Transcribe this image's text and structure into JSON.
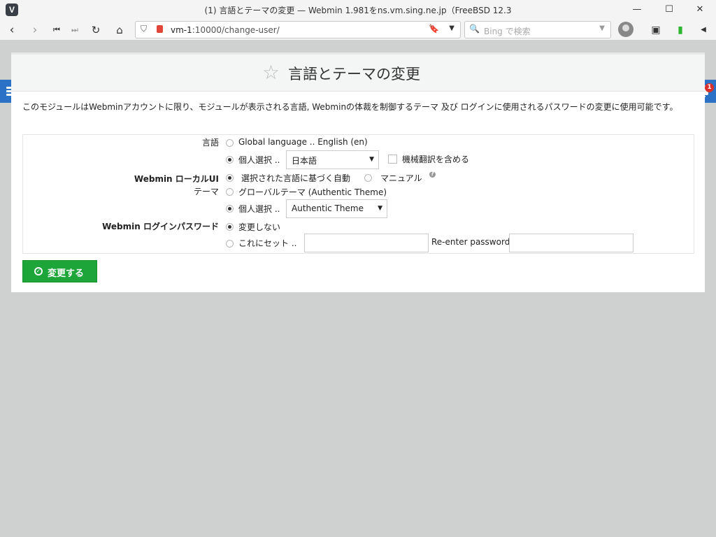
{
  "window": {
    "title": "(1) 言語とテーマの変更 — Webmin 1.981をns.vm.sing.ne.jp（FreeBSD 12.3",
    "minimize": "—",
    "maximize": "☐",
    "close": "✕"
  },
  "browser": {
    "back_icon": "chevron-left-icon",
    "forward_icon": "chevron-right-icon",
    "url_host": "vm-1",
    "url_rest": ":10000/change-user/",
    "search_placeholder": "Bing で検索"
  },
  "page": {
    "title": "言語とテーマの変更",
    "description": "このモジュールはWebminアカウントに限り、モジュールが表示される言語, Webminの体裁を制御するテーマ 及び ログインに使用されるパスワードの変更に使用可能です。",
    "notification_count": "1"
  },
  "form": {
    "language_label": "言語",
    "global_language": "Global language .. English (en)",
    "personal_choice": "個人選択 ..",
    "language_value": "日本語",
    "machine_translation": "機械翻訳を含める",
    "local_ui_label": "Webmin ローカルUI",
    "auto_by_language": "選択された言語に基づく自動",
    "manual": "マニュアル",
    "theme_label": "テーマ",
    "global_theme": "グローバルテーマ (Authentic Theme)",
    "personal_theme_choice": "個人選択 ..",
    "theme_value": "Authentic Theme",
    "password_label": "Webmin ログインパスワード",
    "no_change": "変更しない",
    "set_to": "これにセット ..",
    "reenter_password": "Re-enter password",
    "save_button": "変更する"
  }
}
